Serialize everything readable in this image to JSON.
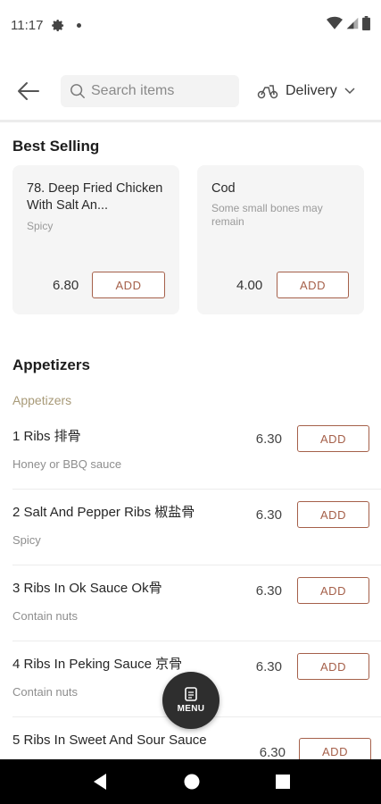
{
  "status": {
    "time": "11:17"
  },
  "header": {
    "search_placeholder": "Search items",
    "mode": "Delivery"
  },
  "best_selling": {
    "title": "Best Selling",
    "items": [
      {
        "name": "78. Deep Fried Chicken With Salt An...",
        "desc": "Spicy",
        "price": "6.80",
        "add_label": "ADD"
      },
      {
        "name": "Cod",
        "desc": "Some small bones may remain",
        "price": "4.00",
        "add_label": "ADD"
      }
    ]
  },
  "menu": {
    "section_title": "Appetizers",
    "category_label": "Appetizers",
    "items": [
      {
        "name": "1 Ribs 排骨",
        "desc": "Honey or BBQ sauce",
        "price": "6.30",
        "add_label": "ADD"
      },
      {
        "name": "2 Salt And Pepper Ribs 椒盐骨",
        "desc": "Spicy",
        "price": "6.30",
        "add_label": "ADD"
      },
      {
        "name": "3 Ribs In Ok Sauce Ok骨",
        "desc": "Contain nuts",
        "price": "6.30",
        "add_label": "ADD"
      },
      {
        "name": "4 Ribs In Peking Sauce 京骨",
        "desc": "Contain nuts",
        "price": "6.30",
        "add_label": "ADD"
      },
      {
        "name": "5 Ribs In Sweet And Sour Sauce",
        "desc": "",
        "price": "6.30",
        "add_label": "ADD"
      }
    ]
  },
  "fab": {
    "label": "MENU"
  },
  "colors": {
    "accent": "#a5604a",
    "category": "#a89a78"
  }
}
